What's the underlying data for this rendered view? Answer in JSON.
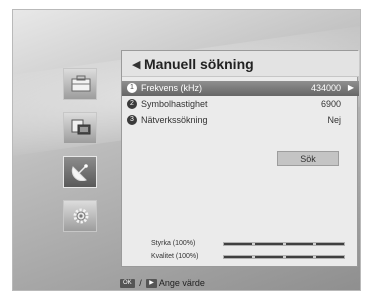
{
  "screen": {
    "title": "Manuell sökning",
    "rows": [
      {
        "num": "1",
        "label": "Frekvens (kHz)",
        "value": "434000"
      },
      {
        "num": "2",
        "label": "Symbolhastighet",
        "value": "6900"
      },
      {
        "num": "3",
        "label": "Nätverkssökning",
        "value": "Nej"
      }
    ],
    "search_button": "Sök",
    "signal": [
      {
        "label": "Styrka (100%)",
        "level": 1.0
      },
      {
        "label": "Kvalitet (100%)",
        "level": 1.0
      }
    ]
  },
  "sidebar": {
    "items": [
      {
        "icon": "folder-icon"
      },
      {
        "icon": "screen-icon"
      },
      {
        "icon": "satellite-dish-icon",
        "active": true
      },
      {
        "icon": "gear-icon"
      }
    ]
  },
  "hint": {
    "ok_key": "OK",
    "separator": "/",
    "arrow_key": "▶",
    "text": "Ange värde"
  }
}
